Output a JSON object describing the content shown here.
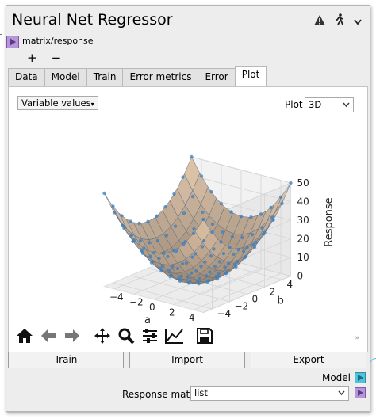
{
  "window": {
    "title": "Neural Net Regressor"
  },
  "header": {
    "icons": [
      "warning-icon",
      "run-icon",
      "chevron-down-icon"
    ]
  },
  "input_port": {
    "label": "matrix/response"
  },
  "toolbar": {
    "plus": "+",
    "minus": "−"
  },
  "tabs": [
    {
      "label": "Data"
    },
    {
      "label": "Model"
    },
    {
      "label": "Train"
    },
    {
      "label": "Error metrics"
    },
    {
      "label": "Error"
    },
    {
      "label": "Plot"
    }
  ],
  "active_tab": "Plot",
  "plot_panel": {
    "variable_dropdown": "Variable values",
    "plot_label": "Plot",
    "plot_mode": "3D"
  },
  "chart_data": {
    "type": "scatter",
    "subtype": "3d surface with scatter points",
    "x_label": "a",
    "y_label": "b",
    "z_label": "Response",
    "x_ticks": [
      "−4",
      "−2",
      "0",
      "2",
      "4"
    ],
    "y_ticks": [
      "−4",
      "−2",
      "0",
      "2",
      "4"
    ],
    "z_ticks": [
      "0",
      "10",
      "20",
      "30",
      "40",
      "50"
    ],
    "x_range": [
      -5,
      5
    ],
    "y_range": [
      -5,
      5
    ],
    "z_range": [
      0,
      50
    ],
    "surface": "response = a^2 + b^2 (paraboloid)",
    "colors": {
      "surface": "#d8c2ac",
      "points": "#3a7fbd"
    }
  },
  "plot_toolbar": [
    "home-icon",
    "back-icon",
    "forward-icon",
    "pan-icon",
    "zoom-icon",
    "configure-icon",
    "edit-axes-icon",
    "save-icon"
  ],
  "buttons": {
    "train": "Train",
    "import": "Import",
    "export": "Export"
  },
  "output": {
    "model_label": "Model",
    "response_label": "Response matrix",
    "response_value": "list"
  }
}
